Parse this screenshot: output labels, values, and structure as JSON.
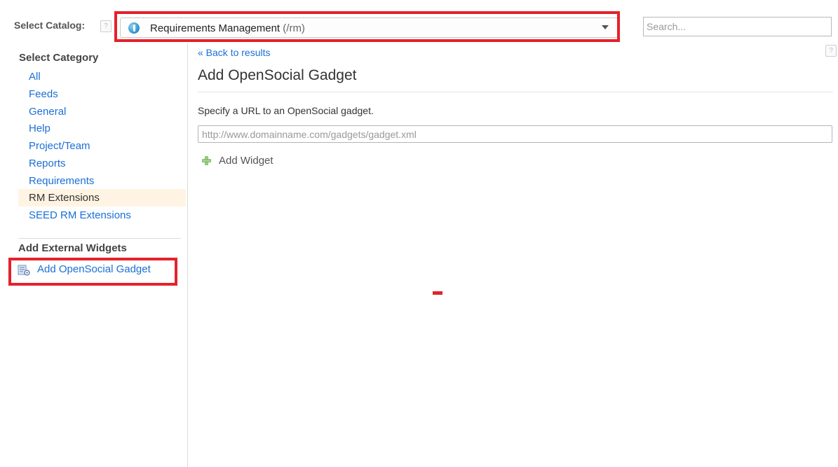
{
  "catalog": {
    "label": "Select Catalog:",
    "help_glyph": "?",
    "icon": "catalog-info-icon",
    "selected_name": "Requirements Management",
    "selected_path": "(/rm)"
  },
  "search": {
    "placeholder": "Search..."
  },
  "sidebar": {
    "category_heading": "Select Category",
    "categories": [
      {
        "label": "All",
        "selected": false
      },
      {
        "label": "Feeds",
        "selected": false
      },
      {
        "label": "General",
        "selected": false
      },
      {
        "label": "Help",
        "selected": false
      },
      {
        "label": "Project/Team",
        "selected": false
      },
      {
        "label": "Reports",
        "selected": false
      },
      {
        "label": "Requirements",
        "selected": false
      },
      {
        "label": "RM Extensions",
        "selected": true
      },
      {
        "label": "SEED RM Extensions",
        "selected": false
      }
    ],
    "external_heading": "Add External Widgets",
    "external_link": "Add OpenSocial Gadget"
  },
  "main": {
    "back_link": "« Back to results",
    "help_glyph": "?",
    "title": "Add OpenSocial Gadget",
    "instructions": "Specify a URL to an OpenSocial gadget.",
    "url_placeholder": "http://www.domainname.com/gadgets/gadget.xml",
    "add_widget_label": "Add Widget"
  },
  "colors": {
    "link": "#1a6fd6",
    "highlight": "#e3222c",
    "selected_bg": "#fff4e3"
  }
}
